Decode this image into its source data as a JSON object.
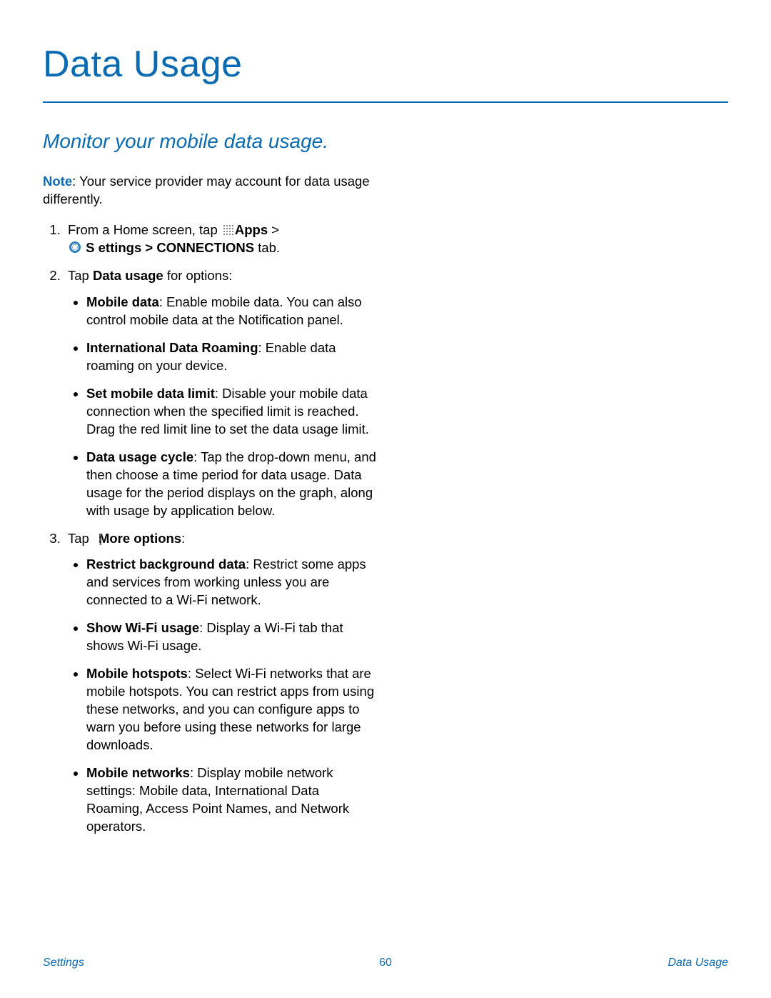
{
  "title": "Data Usage",
  "subtitle": "Monitor your mobile data usage.",
  "note": {
    "label": "Note",
    "text": ": Your service provider may account for data usage differently."
  },
  "steps": {
    "s1": {
      "pre": "From a Home screen, tap ",
      "apps": "Apps",
      "gt1": " > ",
      "settings": "S ettings",
      "gt2": " > ",
      "conn": "CONNECTIONS",
      "tab": " tab."
    },
    "s2": {
      "pre": "Tap ",
      "du": "Data usage",
      "post": " for options:",
      "items": {
        "i1": {
          "label": "Mobile data",
          "text": ": Enable mobile data. You can also control mobile data at the Notification panel."
        },
        "i2": {
          "label": "International Data Roaming",
          "text": ": Enable data roaming on your device."
        },
        "i3": {
          "label": "Set mobile data limit",
          "text": ": Disable your mobile data connection when the specified limit is reached. Drag the red limit line to set the data usage limit."
        },
        "i4": {
          "label": "Data usage cycle",
          "text": ": Tap the drop-down menu, and then choose a time period for data usage. Data usage for the period displays on the graph, along with usage by application below."
        }
      }
    },
    "s3": {
      "pre": "Tap ",
      "more": "More options",
      "post": ":",
      "items": {
        "i1": {
          "label": "Restrict background data",
          "text": ": Restrict some apps and services from working unless you are connected to a Wi-Fi network."
        },
        "i2": {
          "label": "Show Wi-Fi usage",
          "text": ": Display a Wi-Fi tab that shows Wi-Fi usage."
        },
        "i3": {
          "label": "Mobile hotspots",
          "text": ": Select Wi-Fi networks that are mobile hotspots. You can restrict apps from using these networks, and you can configure apps to warn you before using these networks for large downloads."
        },
        "i4": {
          "label": "Mobile networks",
          "text": ": Display mobile network settings: Mobile data, International Data Roaming, Access Point Names, and Network operators."
        }
      }
    }
  },
  "footer": {
    "left": "Settings",
    "center": "60",
    "right": "Data Usage"
  }
}
